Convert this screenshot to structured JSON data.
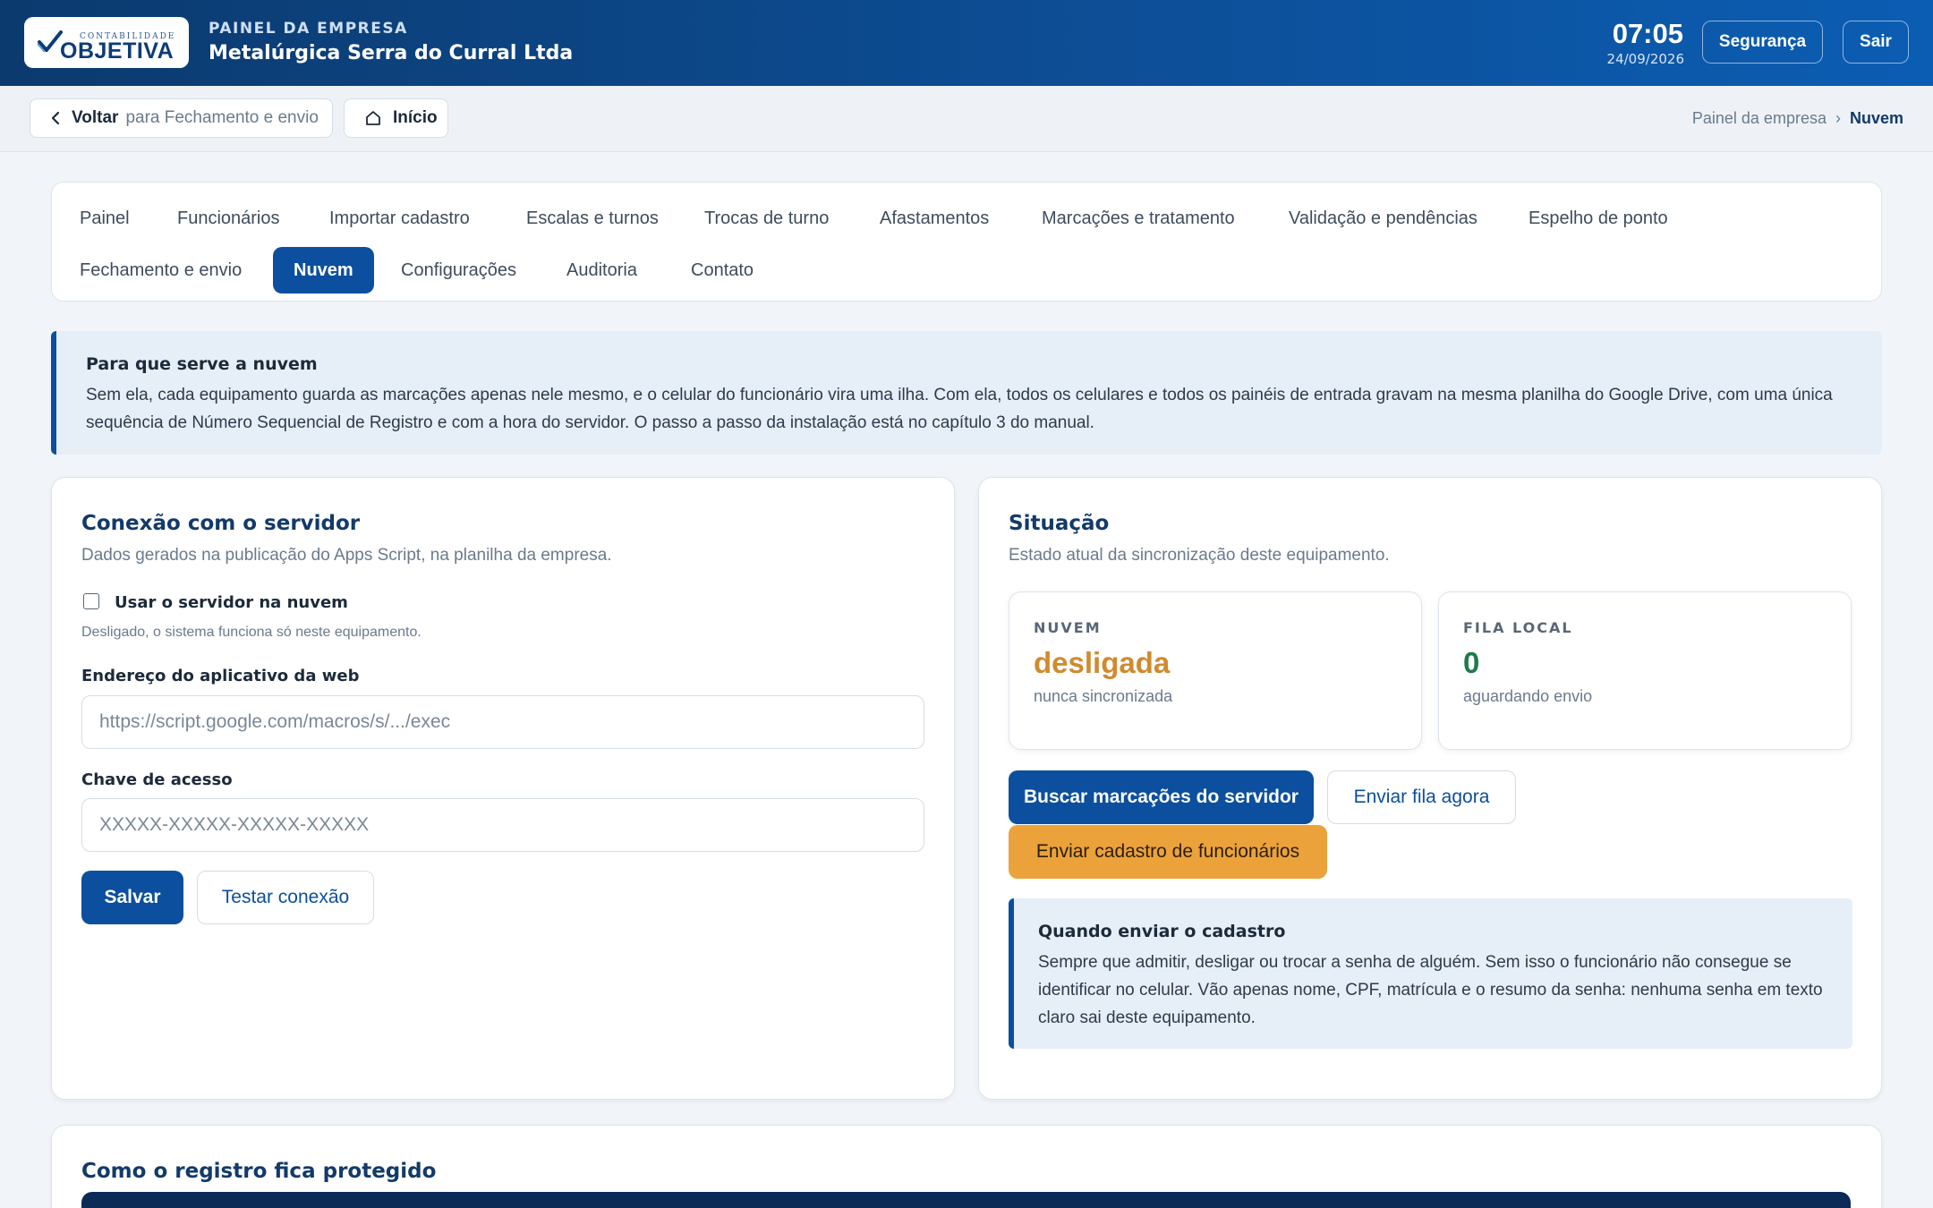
{
  "header": {
    "logo_small": "CONTABILIDADE",
    "logo_big": "OBJETIVA",
    "kicker": "PAINEL DA EMPRESA",
    "company": "Metalúrgica Serra do Curral Ltda",
    "time": "07:05",
    "date": "24/09/2026",
    "security_label": "Segurança",
    "exit_label": "Sair"
  },
  "subbar": {
    "back_strong": "Voltar",
    "back_muted": "para Fechamento e envio",
    "home_label": "Início",
    "breadcrumb": [
      "Painel da empresa",
      "Nuvem"
    ],
    "breadcrumb_sep": "›"
  },
  "tabs": [
    {
      "label": "Painel"
    },
    {
      "label": "Funcionários"
    },
    {
      "label": "Importar cadastro"
    },
    {
      "label": "Escalas e turnos"
    },
    {
      "label": "Trocas de turno"
    },
    {
      "label": "Afastamentos"
    },
    {
      "label": "Marcações e tratamento"
    },
    {
      "label": "Validação e pendências"
    },
    {
      "label": "Espelho de ponto"
    },
    {
      "label": "Fechamento e envio"
    },
    {
      "label": "Nuvem"
    },
    {
      "label": "Configurações"
    },
    {
      "label": "Auditoria"
    },
    {
      "label": "Contato"
    }
  ],
  "active_tab": "Nuvem",
  "info": {
    "title": "Para que serve a nuvem",
    "body": "Sem ela, cada equipamento guarda as marcações apenas nele mesmo, e o celular do funcionário vira uma ilha. Com ela, todos os celulares e todos os painéis de entrada gravam na mesma planilha do Google Drive, com uma única sequência de Número Sequencial de Registro e com a hora do servidor. O passo a passo da instalação está no capítulo 3 do manual."
  },
  "connection": {
    "title": "Conexão com o servidor",
    "subtitle": "Dados gerados na publicação do Apps Script, na planilha da empresa.",
    "checkbox_label": "Usar o servidor na nuvem",
    "checkbox_checked": false,
    "checkbox_help": "Desligado, o sistema funciona só neste equipamento.",
    "url_label": "Endereço do aplicativo da web",
    "url_value": "",
    "url_placeholder": "https://script.google.com/macros/s/.../exec",
    "key_label": "Chave de acesso",
    "key_value": "",
    "key_placeholder": "XXXXX-XXXXX-XXXXX-XXXXX",
    "save_label": "Salvar",
    "test_label": "Testar conexão"
  },
  "status": {
    "title": "Situação",
    "subtitle": "Estado atual da sincronização deste equipamento.",
    "cloud_label": "NUVEM",
    "cloud_value": "desligada",
    "cloud_sub": "nunca sincronizada",
    "queue_label": "FILA LOCAL",
    "queue_value": "0",
    "queue_sub": "aguardando envio",
    "fetch_label": "Buscar marcações do servidor",
    "send_queue_label": "Enviar fila agora",
    "send_staff_label": "Enviar cadastro de funcionários",
    "note_title": "Quando enviar o cadastro",
    "note_body": "Sempre que admitir, desligar ou trocar a senha de alguém. Sem isso o funcionário não consegue se identificar no celular. Vão apenas nome, CPF, matrícula e o resumo da senha: nenhuma senha em texto claro sai deste equipamento."
  },
  "protection": {
    "title": "Como o registro fica protegido"
  },
  "colors": {
    "brand": "#0b4f9e",
    "cloud_off": "#d08a2e",
    "queue_ok": "#1f7a4c",
    "warn_button": "#eba23b"
  },
  "icons": {
    "back": "chevron-left-icon",
    "home": "home-icon",
    "logo": "check-mark-icon"
  }
}
